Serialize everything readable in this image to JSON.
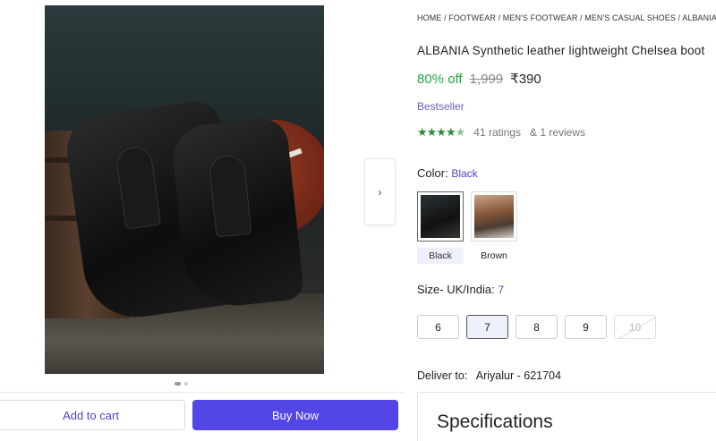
{
  "breadcrumb": "HOME / FOOTWEAR / MEN'S FOOTWEAR / MEN'S CASUAL SHOES / ALBANIA MEN",
  "product": {
    "title": "ALBANIA Synthetic leather lightweight Chelsea boot",
    "discount": "80% off",
    "mrp": "1,999",
    "price": "₹390",
    "badge": "Bestseller",
    "ratings_text": "41 ratings",
    "reviews_text": "& 1 reviews",
    "rating_value": 4.5
  },
  "color": {
    "label": "Color:",
    "selected": "Black",
    "options": [
      {
        "name": "Black",
        "selected": true
      },
      {
        "name": "Brown",
        "selected": false
      }
    ]
  },
  "size": {
    "label": "Size- UK/India:",
    "selected": "7",
    "options": [
      {
        "value": "6",
        "state": "available"
      },
      {
        "value": "7",
        "state": "selected"
      },
      {
        "value": "8",
        "state": "available"
      },
      {
        "value": "9",
        "state": "available"
      },
      {
        "value": "10",
        "state": "unavailable"
      }
    ]
  },
  "delivery": {
    "label": "Deliver to:",
    "location": "Ariyalur - 621704"
  },
  "specifications": {
    "heading": "Specifications"
  },
  "gallery": {
    "next_icon": "chevron-right-icon",
    "next_glyph": "›",
    "page_count": 2,
    "current_page": 1
  },
  "actions": {
    "add_to_cart": "Add to cart",
    "buy_now": "Buy Now"
  },
  "colors": {
    "accent": "#5346e6",
    "discount": "#27a745",
    "stars": "#2d8a3e",
    "link": "#4a44c4"
  }
}
